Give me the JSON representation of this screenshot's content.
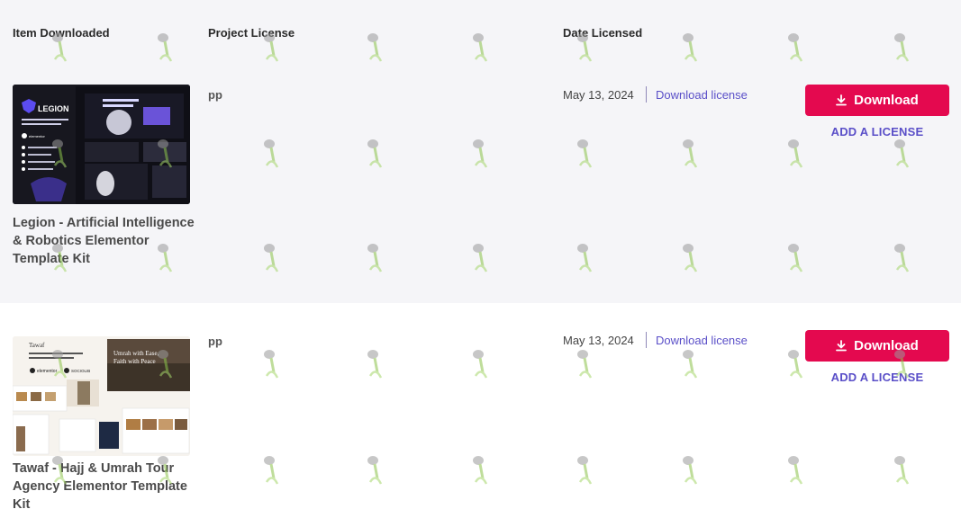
{
  "header": {
    "item_downloaded": "Item Downloaded",
    "project_license": "Project License",
    "date_licensed": "Date Licensed"
  },
  "rows": [
    {
      "title": "Legion - Artificial Intelligence & Robotics Elementor Template Kit",
      "project": "pp",
      "date": "May 13, 2024",
      "download_license": "Download license",
      "download_button": "Download",
      "add_license": "ADD A LICENSE",
      "thumb": {
        "brand": "LEGION",
        "tagline": "Artificial Intelligence & Robotics Elementor Template Kit",
        "badge": "elementor",
        "features": [
          "15 Ready to Use Templates",
          "Using Elementor",
          "Responsive Layout",
          "Fully Customizable"
        ]
      }
    },
    {
      "title": "Tawaf - Hajj & Umrah Tour Agency Elementor Template Kit",
      "project": "pp",
      "date": "May 13, 2024",
      "download_license": "Download license",
      "download_button": "Download",
      "add_license": "ADD A LICENSE",
      "thumb": {
        "brand": "Tawaf",
        "tagline": "Hajj & Umrah Tour Agency Elementor Template Kit",
        "badge": "elementor",
        "badge2": "SOCIOLIB",
        "hero": "Umrah with Ease, Faith with Peace"
      }
    }
  ],
  "colors": {
    "accent": "#e4094f",
    "link": "#5a4fc8",
    "row_alt": "#f5f5f8"
  }
}
